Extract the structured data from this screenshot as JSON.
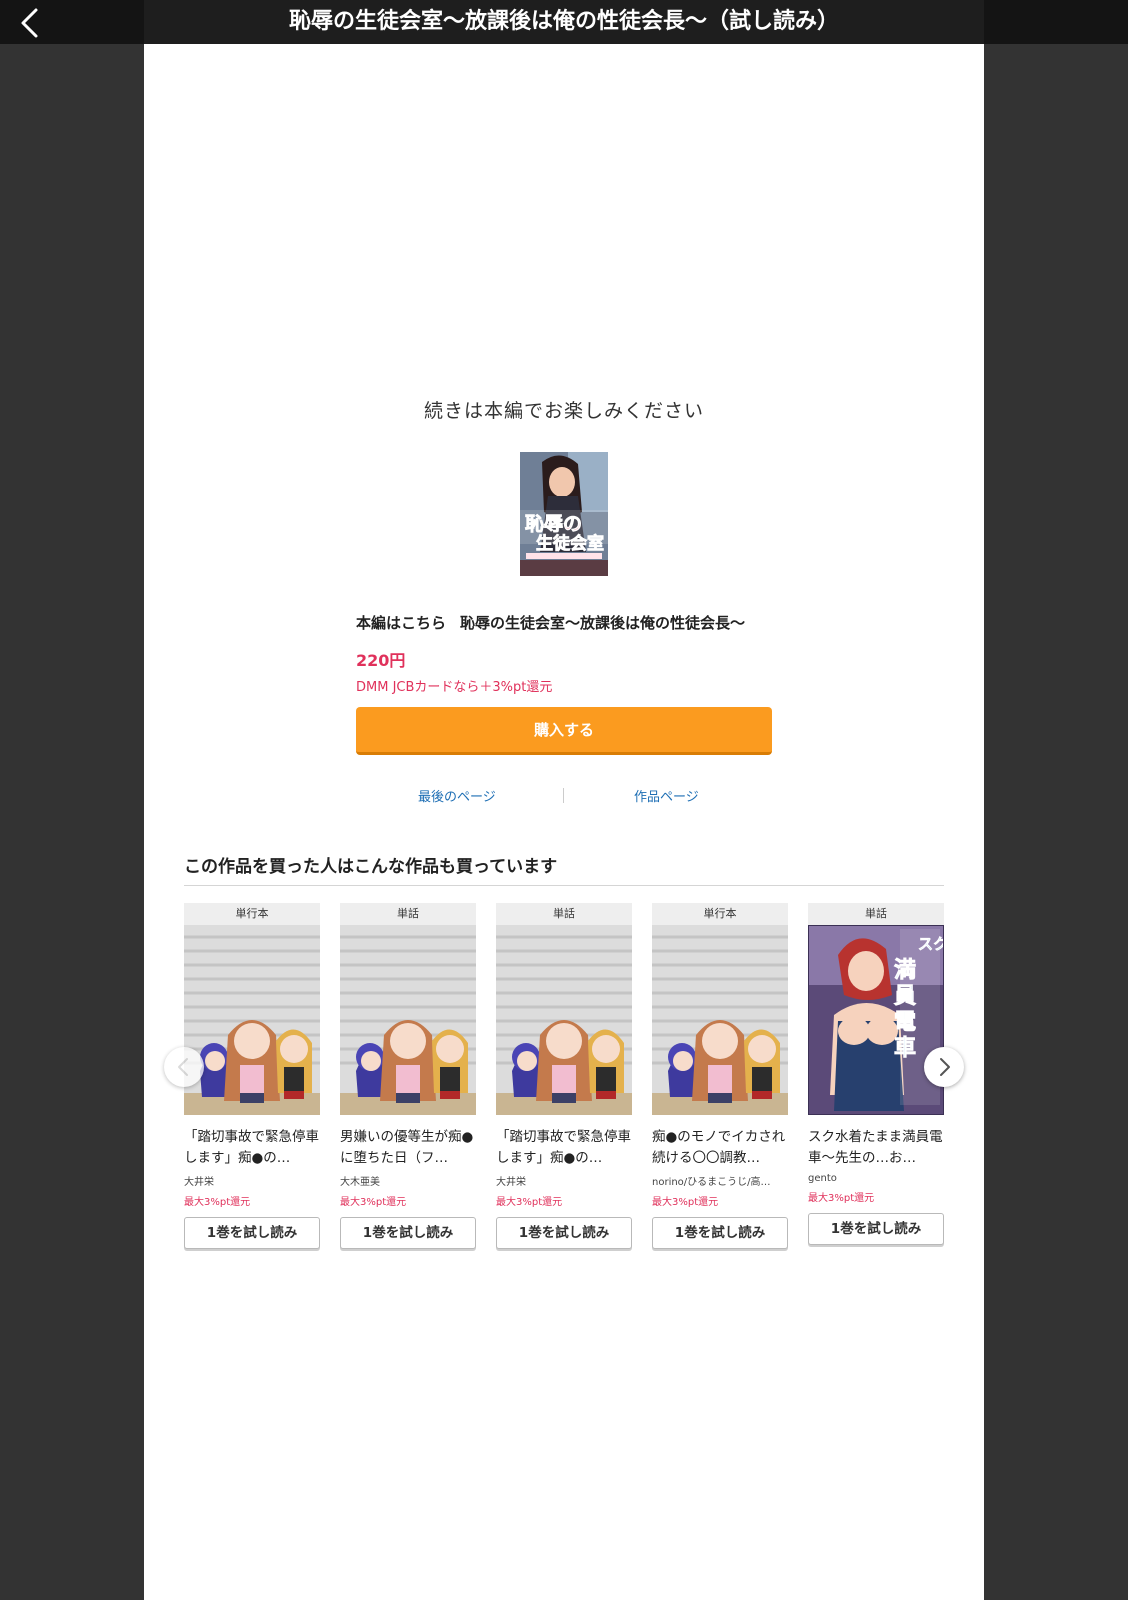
{
  "header": {
    "title": "恥辱の生徒会室〜放課後は俺の性徒会長〜（試し読み）"
  },
  "end_panel": {
    "message": "続きは本編でお楽しみください",
    "main_prefix": "本編はこちら",
    "main_title": "恥辱の生徒会室〜放課後は俺の性徒会長〜",
    "price": "220円",
    "point_note": "DMM JCBカードなら＋3%pt還元",
    "buy_label": "購入する",
    "last_page_link": "最後のページ",
    "work_page_link": "作品ページ"
  },
  "recommendations": {
    "heading": "この作品を買った人はこんな作品も買っています",
    "items": [
      {
        "type": "単行本",
        "title": "「踏切事故で緊急停車します」痴●の…",
        "author": "大井栄",
        "point": "最大3%pt還元",
        "button": "1巻を試し読み"
      },
      {
        "type": "単話",
        "title": "男嫌いの優等生が痴●に堕ちた日（フ…",
        "author": "大木亜美",
        "point": "最大3%pt還元",
        "button": "1巻を試し読み"
      },
      {
        "type": "単話",
        "title": "「踏切事故で緊急停車します」痴●の…",
        "author": "大井栄",
        "point": "最大3%pt還元",
        "button": "1巻を試し読み"
      },
      {
        "type": "単行本",
        "title": "痴●のモノでイカされ続ける〇〇調教…",
        "author": "norino/ひるまこうじ/高…",
        "point": "最大3%pt還元",
        "button": "1巻を試し読み"
      },
      {
        "type": "単話",
        "title": "スク水着たまま満員電車〜先生の…お…",
        "author": "gento",
        "point": "最大3%pt還元",
        "button": "1巻を試し読み"
      }
    ]
  },
  "colors": {
    "accent": "#fb9b1f",
    "price": "#e0315b",
    "link": "#1d6eb4",
    "topbar": "#141414"
  },
  "icons": {
    "back": "chevron-left-icon",
    "prev": "chevron-left-icon",
    "next": "chevron-right-icon"
  }
}
